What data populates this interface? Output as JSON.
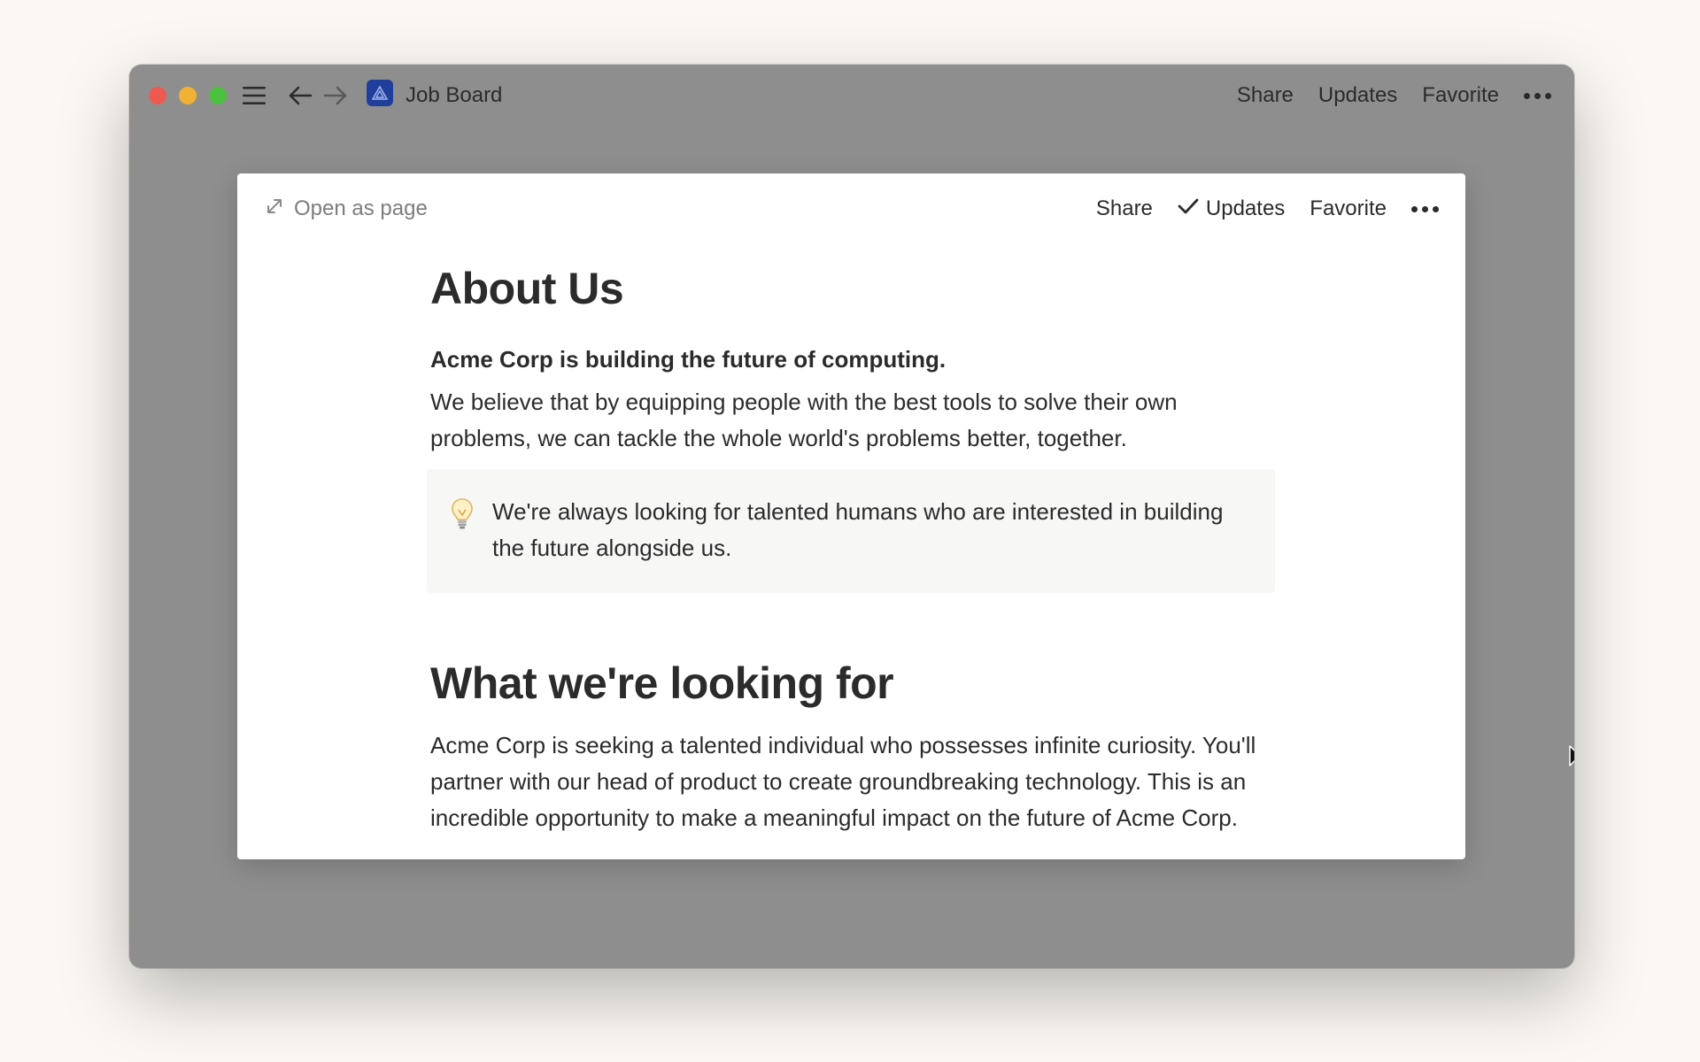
{
  "window": {
    "title": "Job Board",
    "actions": {
      "share": "Share",
      "updates": "Updates",
      "favorite": "Favorite"
    }
  },
  "modal": {
    "open_as_page": "Open as page",
    "actions": {
      "share": "Share",
      "updates": "Updates",
      "favorite": "Favorite"
    }
  },
  "page": {
    "heading1": "About Us",
    "lead": "Acme Corp is building the future of computing.",
    "paragraph1": "We believe that by equipping people with the best tools to solve their own problems, we can tackle the whole world's problems better, together.",
    "callout": "We're always looking for talented humans who are interested in building the future alongside us.",
    "heading2": "What we're looking for",
    "paragraph2": "Acme Corp is seeking a talented individual who possesses infinite curiosity. You'll partner with our head of product to create groundbreaking technology. This is an incredible opportunity to make a meaningful impact on the future of Acme Corp."
  },
  "help": {
    "label": "?"
  },
  "icons": {
    "sidebar": "hamburger-menu-icon",
    "back": "arrow-left-icon",
    "forward": "arrow-right-icon",
    "app": "job-board-app-icon",
    "more": "ellipsis-icon",
    "expand": "expand-arrows-icon",
    "check": "checkmark-icon",
    "callout": "lightbulb-icon",
    "cursor": "mouse-pointer-icon"
  },
  "colors": {
    "background": "#fbf8f3",
    "window_dim": "#8e8e8e",
    "traffic_red": "#ee5a52",
    "traffic_yellow": "#f0b135",
    "traffic_green": "#4cc13f",
    "app_badge": "#1f3f9a",
    "text": "#2b2b2b",
    "muted_text": "#7d7d7d",
    "callout_bg": "#f7f7f6"
  }
}
